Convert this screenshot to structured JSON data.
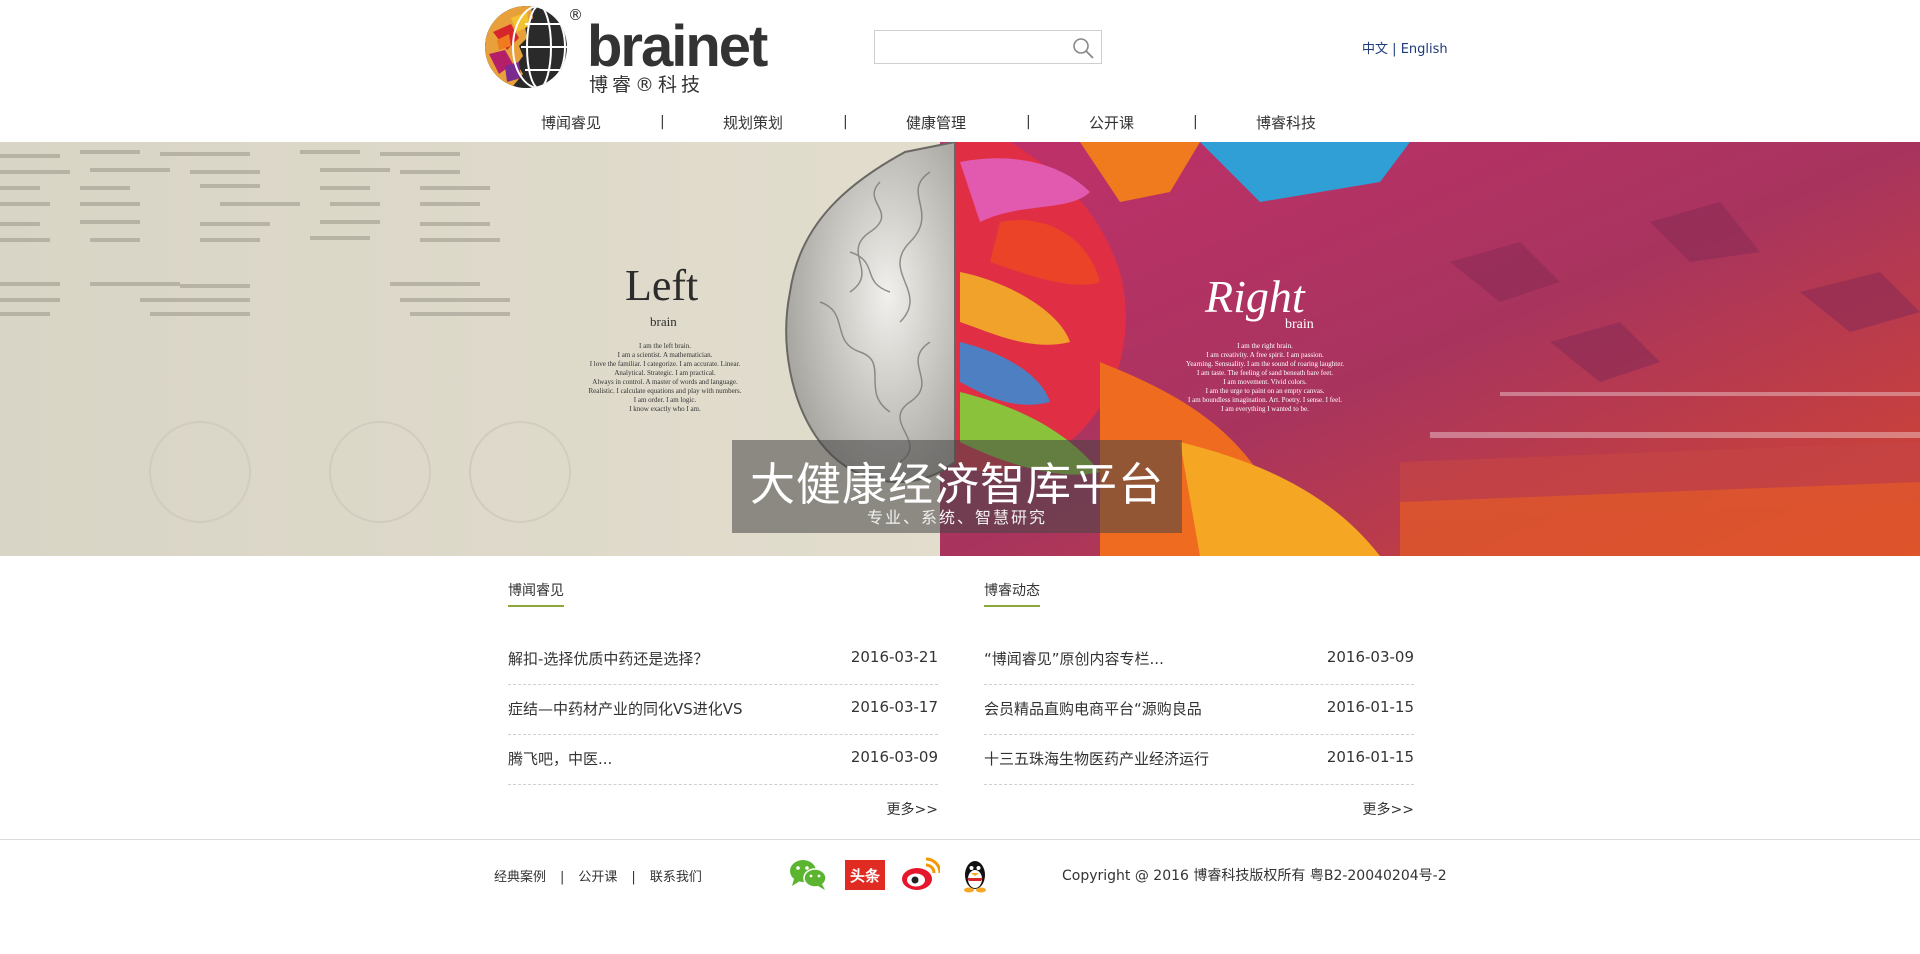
{
  "brand": {
    "wordmark": "brainet",
    "registered": "®",
    "subtitle": "博睿®科技"
  },
  "search": {
    "placeholder": "",
    "value": ""
  },
  "lang": {
    "zh": "中文",
    "sep": "|",
    "en": "English"
  },
  "nav": {
    "items": [
      "博闻睿见",
      "规划策划",
      "健康管理",
      "公开课",
      "博睿科技"
    ],
    "sep": "|"
  },
  "banner": {
    "title": "大健康经济智库平台",
    "subtitle": "专业、系统、智慧研究",
    "left_word": "Left",
    "left_sub": "brain",
    "right_word": "Right",
    "right_sub": "brain",
    "left_text": [
      "I am the left brain.",
      "I am a scientist. A mathematician.",
      "I love the familiar. I categorize. I am accurate. Linear.",
      "Analytical. Strategic. I am practical.",
      "Always in control. A master of words and language.",
      "Realistic. I calculate equations and play with numbers.",
      "I am order. I am logic.",
      "I know exactly who I am."
    ],
    "right_text": [
      "I am the right brain.",
      "I am creativity. A free spirit. I am passion.",
      "Yearning. Sensuality. I am the sound of roaring laughter.",
      "I am taste. The feeling of sand beneath bare feet.",
      "I am movement. Vivid colors.",
      "I am the urge to paint on an empty canvas.",
      "I am boundless imagination. Art. Poetry. I sense. I feel.",
      "I am everything I wanted to be."
    ]
  },
  "news_left": {
    "title": "博闻睿见",
    "items": [
      {
        "title": "解扣-选择优质中药还是选择？",
        "date": "2016-03-21"
      },
      {
        "title": "症结—中药材产业的同化VS进化VS",
        "date": "2016-03-17"
      },
      {
        "title": "腾飞吧，中医...",
        "date": "2016-03-09"
      }
    ],
    "more": "更多>>"
  },
  "news_right": {
    "title": "博睿动态",
    "items": [
      {
        "title": "“博闻睿见”原创内容专栏...",
        "date": "2016-03-09"
      },
      {
        "title": "会员精品直购电商平台“源购良品",
        "date": "2016-01-15"
      },
      {
        "title": "十三五珠海生物医药产业经济运行",
        "date": "2016-01-15"
      }
    ],
    "more": "更多>>"
  },
  "footer": {
    "links": [
      "经典案例",
      "公开课",
      "联系我们"
    ],
    "sep": "|",
    "toutiao": "头条",
    "copyright": "Copyright @ 2016 博睿科技版权所有  粤B2-20040204号-2"
  },
  "colors": {
    "accent_green": "#8aa83b",
    "logo_red": "#d7262b",
    "toutiao_red": "#e02b22",
    "wechat_green": "#5cb531",
    "lang_blue": "#1d3a7a"
  }
}
